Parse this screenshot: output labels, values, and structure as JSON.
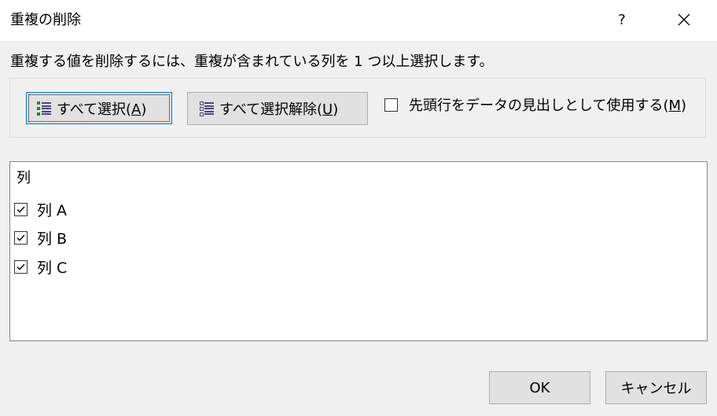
{
  "window": {
    "title": "重複の削除",
    "help_label": "?"
  },
  "instruction": "重複する値を削除するには、重複が含まれている列を 1 つ以上選択します。",
  "buttons": {
    "select_all": {
      "text": "すべて選択(",
      "accel": "A",
      "suffix": ")"
    },
    "deselect_all": {
      "text": "すべて選択解除(",
      "accel": "U",
      "suffix": ")"
    },
    "ok": "OK",
    "cancel": "キャンセル"
  },
  "header_option": {
    "text": "先頭行をデータの見出しとして使用する(",
    "accel": "M",
    "suffix": ")",
    "checked": false
  },
  "columns": {
    "header": "列",
    "items": [
      {
        "label": "列 A",
        "checked": true
      },
      {
        "label": "列 B",
        "checked": true
      },
      {
        "label": "列 C",
        "checked": true
      }
    ]
  },
  "icons": {
    "close": "close-icon",
    "select_all": "select-all-list-icon",
    "deselect_all": "deselect-all-list-icon",
    "check": "check-icon"
  }
}
